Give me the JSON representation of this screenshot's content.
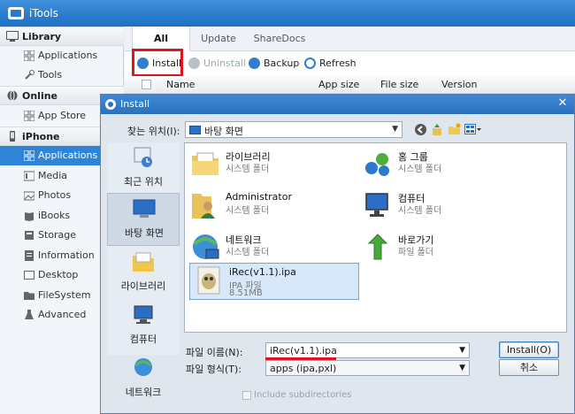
{
  "app": {
    "title": "iTools"
  },
  "sidebar": {
    "groups": [
      {
        "label": "Library",
        "icon": "monitor-icon",
        "items": [
          {
            "label": "Applications",
            "icon": "grid-icon"
          },
          {
            "label": "Tools",
            "icon": "wrench-icon"
          }
        ]
      },
      {
        "label": "Online",
        "icon": "globe-icon",
        "items": [
          {
            "label": "App Store",
            "icon": "grid-icon"
          }
        ]
      },
      {
        "label": "iPhone",
        "icon": "phone-icon",
        "items": [
          {
            "label": "Applications",
            "icon": "grid-icon",
            "active": true
          },
          {
            "label": "Media",
            "icon": "media-icon"
          },
          {
            "label": "Photos",
            "icon": "photos-icon"
          },
          {
            "label": "iBooks",
            "icon": "book-icon"
          },
          {
            "label": "Storage",
            "icon": "storage-icon"
          },
          {
            "label": "Information",
            "icon": "info-icon"
          },
          {
            "label": "Desktop",
            "icon": "desktop-icon"
          },
          {
            "label": "FileSystem",
            "icon": "folder-icon"
          },
          {
            "label": "Advanced",
            "icon": "flask-icon"
          }
        ]
      }
    ]
  },
  "tabs": [
    {
      "label": "All",
      "active": true
    },
    {
      "label": "Update"
    },
    {
      "label": "ShareDocs"
    }
  ],
  "toolbar": {
    "install": "Install",
    "uninstall": "Uninstall",
    "backup": "Backup",
    "refresh": "Refresh"
  },
  "columns": {
    "name": "Name",
    "app_size": "App size",
    "file_size": "File size",
    "version": "Version"
  },
  "dialog": {
    "title": "Install",
    "close": "✕",
    "look_in_label": "찾는 위치(I):",
    "look_in_value": "바탕 화면",
    "places": [
      {
        "label": "최근 위치",
        "icon": "recent-places-icon"
      },
      {
        "label": "바탕 화면",
        "icon": "desktop-place-icon",
        "active": true
      },
      {
        "label": "라이브러리",
        "icon": "libraries-icon"
      },
      {
        "label": "컴퓨터",
        "icon": "computer-icon"
      },
      {
        "label": "네트워크",
        "icon": "network-icon"
      }
    ],
    "files": [
      {
        "name": "라이브러리",
        "type": "시스템 폴더",
        "icon": "library-folder-icon"
      },
      {
        "name": "홈 그룹",
        "type": "시스템 폴더",
        "icon": "homegroup-icon"
      },
      {
        "name": "Administrator",
        "type": "시스템 폴더",
        "icon": "user-folder-icon"
      },
      {
        "name": "컴퓨터",
        "type": "시스템 폴더",
        "icon": "computer-icon"
      },
      {
        "name": "네트워크",
        "type": "시스템 폴더",
        "icon": "network-icon"
      },
      {
        "name": "바로가기",
        "type": "파일 폴더",
        "icon": "shortcut-folder-icon"
      },
      {
        "name": "iRec(v1.1).ipa",
        "type": "IPA 파일",
        "size": "8.51MB",
        "icon": "ipa-file-icon",
        "selected": true
      }
    ],
    "file_name_label": "파일 이름(N):",
    "file_name_value": "iRec(v1.1).ipa",
    "file_type_label": "파일 형식(T):",
    "file_type_value": "apps (ipa,pxl)",
    "install_button": "Install(O)",
    "cancel_button": "취소",
    "include_subdirs": "Include subdirectories"
  },
  "colors": {
    "accent": "#2f84d8",
    "title_bar": "#1f6fc4",
    "highlight": "#e0141e"
  }
}
